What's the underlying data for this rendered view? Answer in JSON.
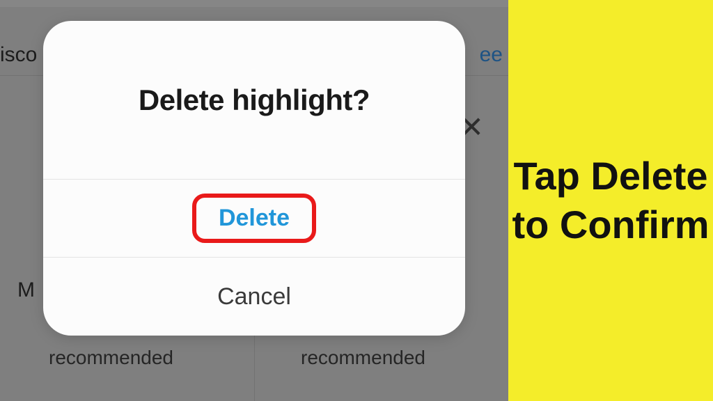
{
  "dialog": {
    "title": "Delete highlight?",
    "delete_label": "Delete",
    "cancel_label": "Cancel"
  },
  "background": {
    "isco_fragment": "isco",
    "ee_fragment": "ee",
    "close_glyph": "✕",
    "m_fragment": "M",
    "recommended_1": "recommended",
    "recommended_2": "recommended"
  },
  "annotation": {
    "text": "Tap Delete to Confirm"
  }
}
